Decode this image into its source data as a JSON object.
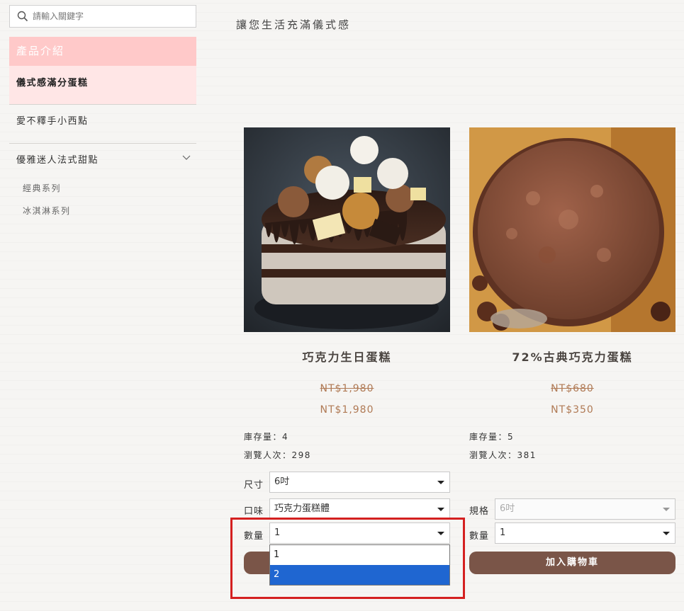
{
  "search": {
    "placeholder": "請輸入關鍵字"
  },
  "sidebar": {
    "header": "產品介紹",
    "items": [
      {
        "label": "儀式感滿分蛋糕"
      },
      {
        "label": "愛不釋手小西點"
      },
      {
        "label": "優雅迷人法式甜點"
      }
    ],
    "sub_items": [
      {
        "label": "經典系列"
      },
      {
        "label": "冰淇淋系列"
      }
    ]
  },
  "page": {
    "title": "讓您生活充滿儀式感"
  },
  "products": [
    {
      "name": "巧克力生日蛋糕",
      "price_old": "NT$1,980",
      "price_new": "NT$1,980",
      "stock": "庫存量：4",
      "views": "瀏覽人次：298",
      "options": [
        {
          "label": "尺寸",
          "value": "6吋"
        },
        {
          "label": "口味",
          "value": "巧克力蛋糕體"
        },
        {
          "label": "數量",
          "value": "1"
        }
      ],
      "button": "",
      "dropdown_options": [
        "1",
        "2"
      ]
    },
    {
      "name": "72%古典巧克力蛋糕",
      "price_old": "NT$680",
      "price_new": "NT$350",
      "stock": "庫存量：5",
      "views": "瀏覽人次：381",
      "options": [
        {
          "label": "規格",
          "value": "6吋"
        },
        {
          "label": "數量",
          "value": "1"
        }
      ],
      "button": "加入購物車"
    }
  ],
  "colors": {
    "accent_pink": "#ffc9c9",
    "button_brown": "#7a5548",
    "price": "#b07a55",
    "highlight": "#d42020",
    "selected": "#1f66d1"
  }
}
